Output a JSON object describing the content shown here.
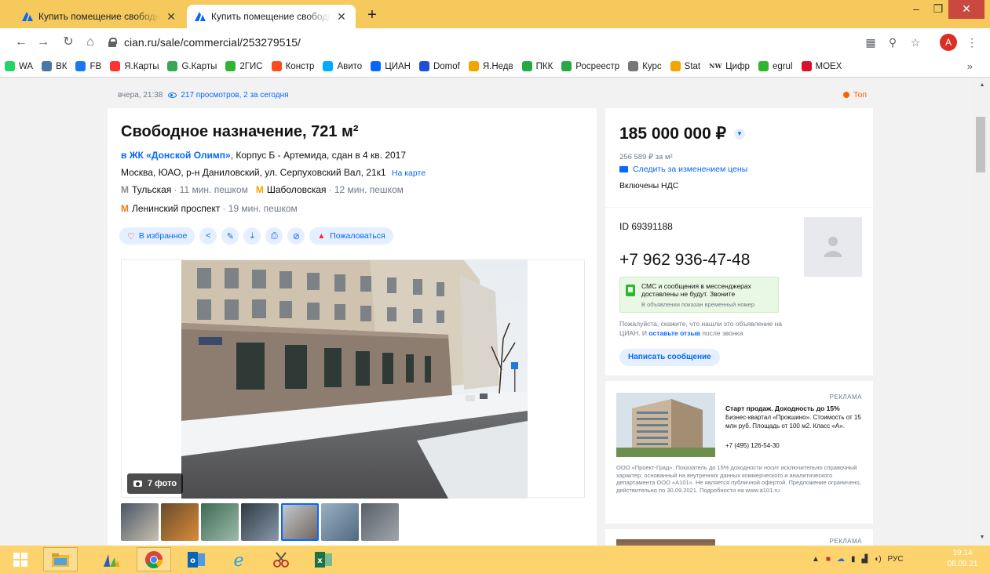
{
  "browser": {
    "tabs": [
      {
        "title": "Купить помещение свободного назначения"
      },
      {
        "title": "Купить помещение свободного назначения"
      }
    ],
    "new_tab_label": "+",
    "url": "cian.ru/sale/commercial/253279515/",
    "profile_initial": "A",
    "bookmarks": [
      {
        "label": "WA",
        "icon": "whatsapp-icon",
        "color": "#25d366"
      },
      {
        "label": "ВК",
        "icon": "vk-icon",
        "color": "#4a76a8"
      },
      {
        "label": "FB",
        "icon": "facebook-icon",
        "color": "#1877f2"
      },
      {
        "label": "Я.Карты",
        "icon": "map-pin-icon",
        "color": "#ff3333"
      },
      {
        "label": "G.Карты",
        "icon": "map-pin-icon",
        "color": "#34a853"
      },
      {
        "label": "2ГИС",
        "icon": "2gis-icon",
        "color": "#2fb52f"
      },
      {
        "label": "Констр",
        "icon": "constructor-icon",
        "color": "#ff4a1c"
      },
      {
        "label": "Авито",
        "icon": "avito-icon",
        "color": "#00aaff"
      },
      {
        "label": "ЦИАН",
        "icon": "cian-icon",
        "color": "#0468ff"
      },
      {
        "label": "Domof",
        "icon": "bookmark-icon",
        "color": "#1d4fd8"
      },
      {
        "label": "Я.Недв",
        "icon": "house-icon",
        "color": "#f5a300"
      },
      {
        "label": "ПКК",
        "icon": "rosreestr-icon",
        "color": "#28a745"
      },
      {
        "label": "Росреестр",
        "icon": "rosreestr-icon",
        "color": "#28a745"
      },
      {
        "label": "Курс",
        "icon": "emblem-icon",
        "color": "#777777"
      },
      {
        "label": "Stat",
        "icon": "stat-icon",
        "color": "#f5a300"
      },
      {
        "label": "Цифр",
        "icon": "nw-icon",
        "color": "#333333",
        "prefix": "NW"
      },
      {
        "label": "egrul",
        "icon": "egrul-icon",
        "color": "#2fb52f"
      },
      {
        "label": "MOEX",
        "icon": "moex-icon",
        "color": "#d8102b"
      }
    ],
    "bookmarks_overflow": "»"
  },
  "listing": {
    "posted": "вчера, 21:38",
    "views": "217 просмотров, 2 за сегодня",
    "top_badge": "Топ",
    "title": "Свободное назначение, 721 м²",
    "jk_link": "в ЖК «Донской Олимп»",
    "jk_details": ", Корпус Б - Артемида, сдан в 4 кв. 2017",
    "address": "Москва, ЮАО, р-н Даниловский, ул. Серпуховский Вал, 21к1",
    "map_link": "На карте",
    "metro": [
      {
        "station": "Тульская",
        "time": "· 11 мин. пешком",
        "color": "#8b8b8b"
      },
      {
        "station": "Шаболовская",
        "time": "· 12 мин. пешком",
        "color": "#f5a300"
      },
      {
        "station": "Ленинский проспект",
        "time": "· 19 мин. пешком",
        "color": "#f07a16"
      }
    ],
    "favorite_label": "В избранное",
    "report_label": "Пожаловаться",
    "photo_count": "7 фото",
    "thumbnails": [
      {
        "colors": [
          "#4a5566",
          "#c8c0b0"
        ]
      },
      {
        "colors": [
          "#6a4b2c",
          "#d88c3a"
        ]
      },
      {
        "colors": [
          "#3d6a54",
          "#9cbcaa"
        ]
      },
      {
        "colors": [
          "#2e3944",
          "#8899aa"
        ]
      },
      {
        "colors": [
          "#c8ccd2",
          "#6e6259"
        ]
      },
      {
        "colors": [
          "#9ab0c4",
          "#4f6a7f"
        ]
      },
      {
        "colors": [
          "#595f66",
          "#a0a6ad"
        ]
      }
    ],
    "selected_thumb": 4
  },
  "price_block": {
    "price": "185 000 000 ₽",
    "per_m2": "256 589 ₽ за м²",
    "follow_price": "Следить за изменением цены",
    "vat": "Включены НДС"
  },
  "contact": {
    "ad_id": "ID 69391188",
    "phone": "+7 962 936-47-48",
    "sms_notice": "СМС и сообщения в мессенджерах доставлены не будут. Звоните",
    "sms_sub": "В объявлении показан временный номер",
    "review_text_1": "Пожалуйста, скажите, что нашли это объявление на ЦИАН. И",
    "review_link": "оставьте отзыв",
    "review_text_2": "после звонка",
    "write_button": "Написать сообщение"
  },
  "ad": {
    "label": "РЕКЛАМА",
    "title": "Старт продаж. Доходность до 15%",
    "description": "Бизнес-квартал «Прокшино». Стоимость от 15 млн руб. Площадь от 100 м2. Класс «А».",
    "phone": "+7 (495) 126-54-30",
    "legal": "ООО «Проект-Град». Показатель до 15% доходности носит исключительно справочный характер, основанный на внутренних данных коммерческого и аналитического департамента ООО «А101». Не является публичной офертой. Предложение ограничено, действительно по 30.09.2021. Подробности на www.a101.ru"
  },
  "ad2": {
    "label": "РЕКЛАМА"
  },
  "taskbar": {
    "tray_language": "РУС",
    "time": "19:14",
    "date": "08.09.21"
  }
}
